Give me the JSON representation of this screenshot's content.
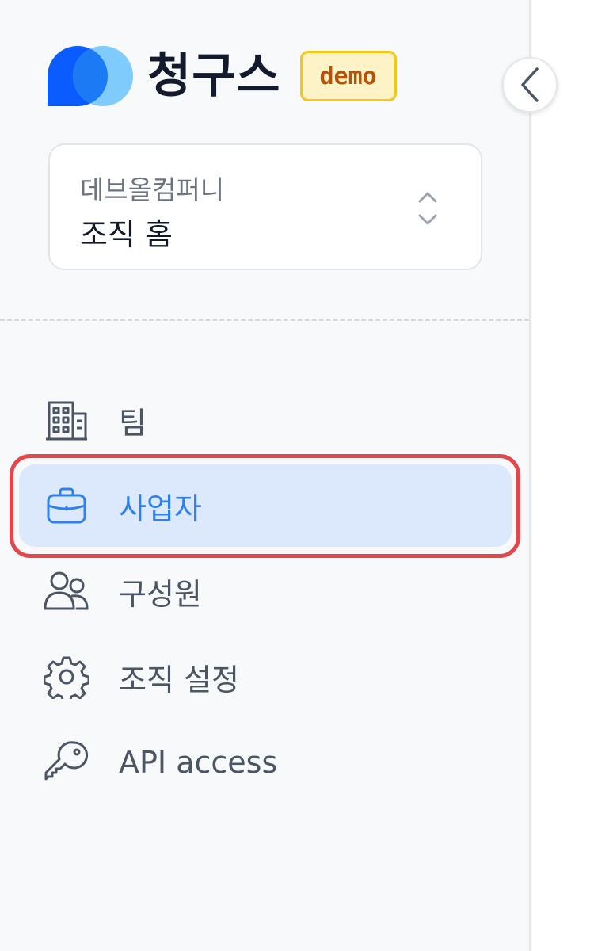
{
  "brand": {
    "name": "청구스",
    "badge": "demo",
    "logo_icon": "two-overlapping-circles-logo"
  },
  "collapse_button": {
    "icon": "chevron-left-icon"
  },
  "org_switcher": {
    "org_name": "데브올컴퍼니",
    "current_page": "조직 홈",
    "icon": "chevron-up-down-icon"
  },
  "nav": {
    "items": [
      {
        "label": "팀",
        "icon": "building-icon",
        "active": false
      },
      {
        "label": "사업자",
        "icon": "briefcase-icon",
        "active": true
      },
      {
        "label": "구성원",
        "icon": "users-icon",
        "active": false
      },
      {
        "label": "조직 설정",
        "icon": "gear-icon",
        "active": false
      },
      {
        "label": "API access",
        "icon": "key-icon",
        "active": false
      }
    ]
  },
  "colors": {
    "accent": "#2f80ed",
    "active_bg": "#dce9fd",
    "highlight": "#e2474c",
    "badge_bg": "#fef3c7",
    "badge_border": "#f5c518",
    "badge_text": "#b45309",
    "logo_dark": "#0a5cff",
    "logo_light": "#7fcbfb"
  }
}
